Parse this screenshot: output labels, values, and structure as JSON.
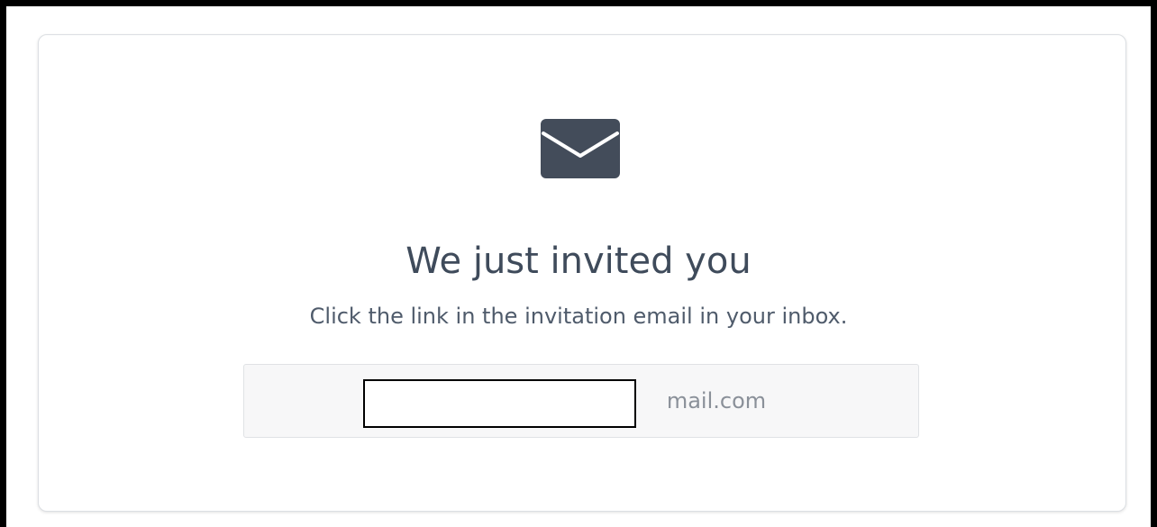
{
  "invite": {
    "icon": "envelope-icon",
    "title": "We just invited you",
    "subtitle": "Click the link in the invitation email in your inbox.",
    "email_value": "mail.com"
  },
  "colors": {
    "icon": "#434c5a",
    "title": "#3f4b5b",
    "subtitle": "#4f5b6b",
    "field_background": "#f7f7f8",
    "field_text": "#8a9099"
  }
}
